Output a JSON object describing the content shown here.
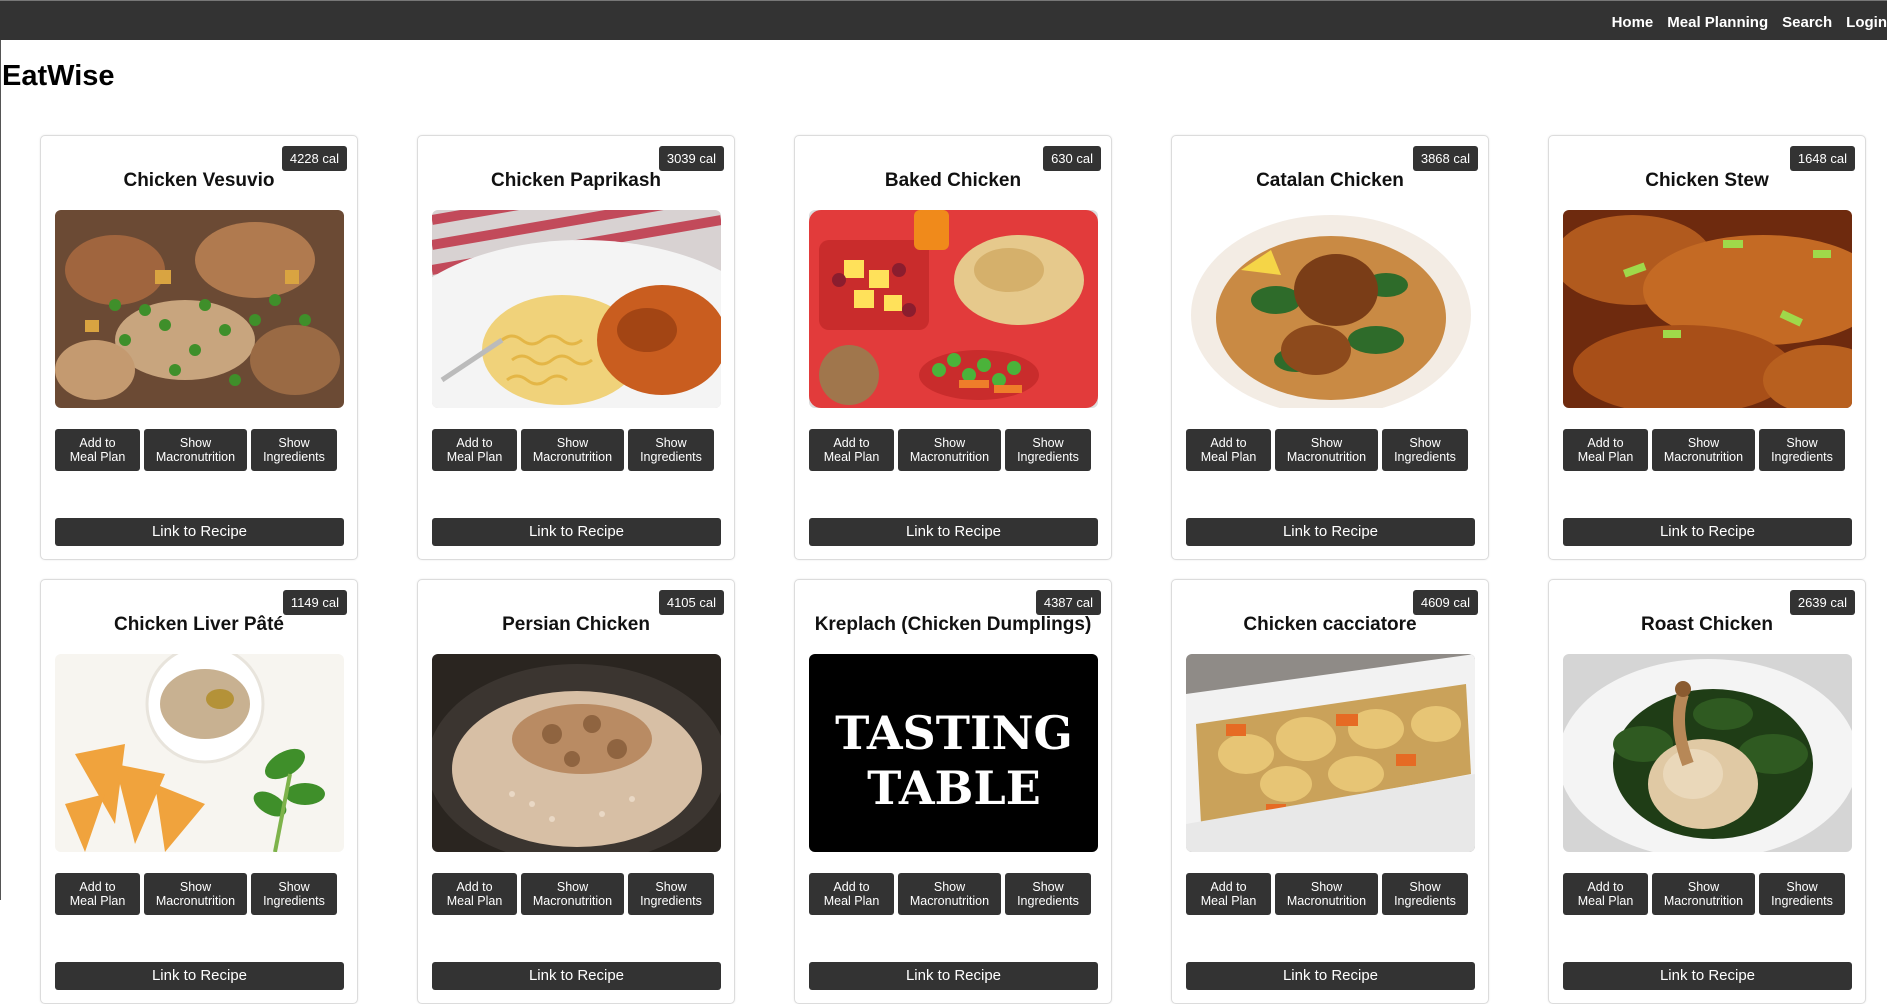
{
  "nav": {
    "links": [
      "Home",
      "Meal Planning",
      "Search",
      "Login"
    ]
  },
  "site": {
    "title": "EatWise"
  },
  "card_labels": {
    "add_to_meal_plan": "Add to\nMeal Plan",
    "show_macronutrition": "Show\nMacronutrition",
    "show_ingredients": "Show\nIngredients",
    "link_to_recipe": "Link to Recipe"
  },
  "recipes": [
    {
      "title": "Chicken Vesuvio",
      "calories": "4228 cal",
      "image": "chicken-vesuvio-photo"
    },
    {
      "title": "Chicken Paprikash",
      "calories": "3039 cal",
      "image": "chicken-paprikash-photo"
    },
    {
      "title": "Baked Chicken",
      "calories": "630 cal",
      "image": "baked-chicken-tray-photo"
    },
    {
      "title": "Catalan Chicken",
      "calories": "3868 cal",
      "image": "catalan-chicken-photo"
    },
    {
      "title": "Chicken Stew",
      "calories": "1648 cal",
      "image": "chicken-stew-photo"
    },
    {
      "title": "Chicken Liver Pâté",
      "calories": "1149 cal",
      "image": "chicken-liver-pate-photo"
    },
    {
      "title": "Persian Chicken",
      "calories": "4105 cal",
      "image": "persian-chicken-photo"
    },
    {
      "title": "Kreplach (Chicken Dumplings)",
      "calories": "4387 cal",
      "image": "tasting-table-logo"
    },
    {
      "title": "Chicken cacciatore",
      "calories": "4609 cal",
      "image": "chicken-cacciatore-photo"
    },
    {
      "title": "Roast Chicken",
      "calories": "2639 cal",
      "image": "roast-chicken-photo"
    }
  ],
  "logo_text": {
    "line1": "TASTING",
    "line2": "TABLE"
  },
  "colors": {
    "navbar": "#333333",
    "button": "#333333",
    "page_bg": "#ffffff"
  }
}
